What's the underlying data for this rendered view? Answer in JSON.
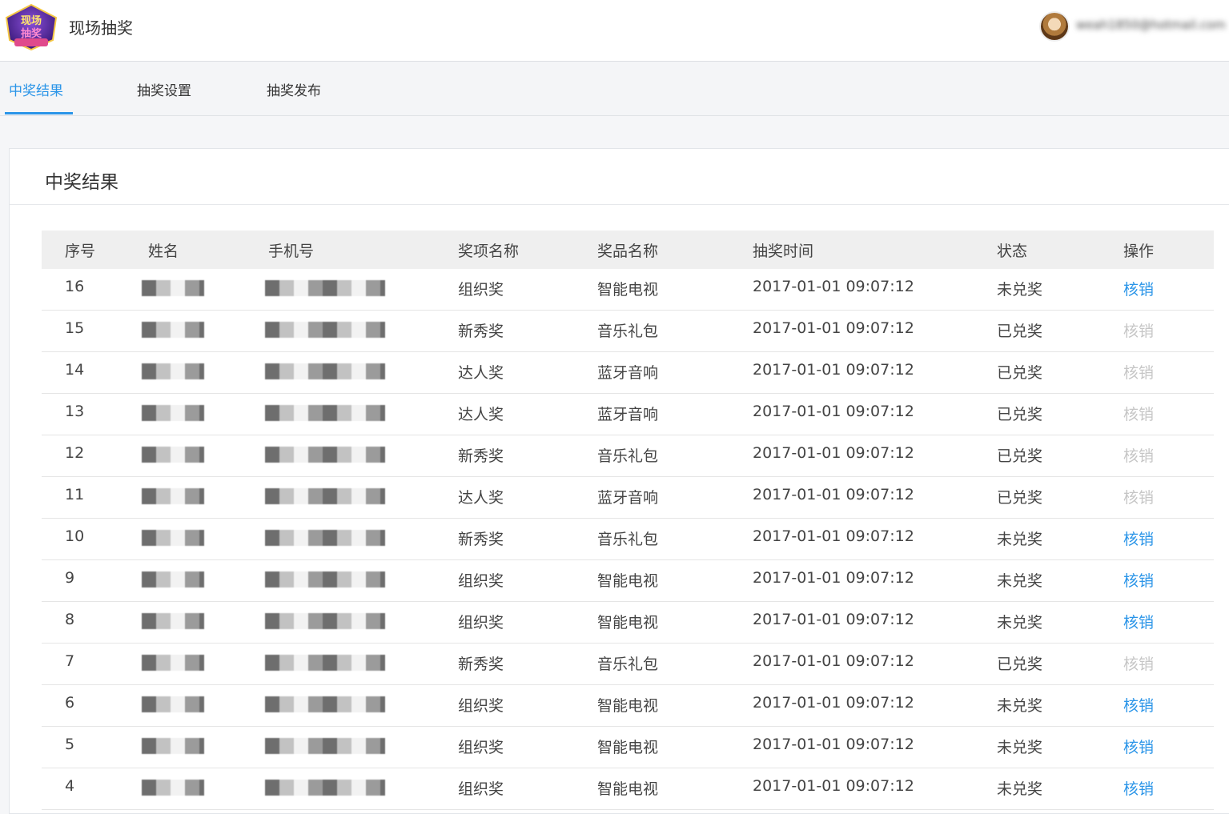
{
  "header": {
    "app_title": "现场抽奖",
    "logo_text_top": "现场",
    "logo_text_bottom": "抽奖",
    "user_email": "weah1850@hotmail.com"
  },
  "tabs": [
    {
      "label": "中奖结果",
      "active": true
    },
    {
      "label": "抽奖设置",
      "active": false
    },
    {
      "label": "抽奖发布",
      "active": false
    }
  ],
  "card": {
    "title": "中奖结果"
  },
  "table": {
    "columns": [
      "序号",
      "姓名",
      "手机号",
      "奖项名称",
      "奖品名称",
      "抽奖时间",
      "状态",
      "操作"
    ],
    "rows": [
      {
        "id": "16",
        "award": "组织奖",
        "prize": "智能电视",
        "time": "2017-01-01  09:07:12",
        "status": "未兑奖",
        "action": "核销",
        "action_enabled": true
      },
      {
        "id": "15",
        "award": "新秀奖",
        "prize": "音乐礼包",
        "time": "2017-01-01  09:07:12",
        "status": "已兑奖",
        "action": "核销",
        "action_enabled": false
      },
      {
        "id": "14",
        "award": "达人奖",
        "prize": "蓝牙音响",
        "time": "2017-01-01  09:07:12",
        "status": "已兑奖",
        "action": "核销",
        "action_enabled": false
      },
      {
        "id": "13",
        "award": "达人奖",
        "prize": "蓝牙音响",
        "time": "2017-01-01  09:07:12",
        "status": "已兑奖",
        "action": "核销",
        "action_enabled": false
      },
      {
        "id": "12",
        "award": "新秀奖",
        "prize": "音乐礼包",
        "time": "2017-01-01  09:07:12",
        "status": "已兑奖",
        "action": "核销",
        "action_enabled": false
      },
      {
        "id": "11",
        "award": "达人奖",
        "prize": "蓝牙音响",
        "time": "2017-01-01  09:07:12",
        "status": "已兑奖",
        "action": "核销",
        "action_enabled": false
      },
      {
        "id": "10",
        "award": "新秀奖",
        "prize": "音乐礼包",
        "time": "2017-01-01  09:07:12",
        "status": "未兑奖",
        "action": "核销",
        "action_enabled": true
      },
      {
        "id": "9",
        "award": "组织奖",
        "prize": "智能电视",
        "time": "2017-01-01  09:07:12",
        "status": "未兑奖",
        "action": "核销",
        "action_enabled": true
      },
      {
        "id": "8",
        "award": "组织奖",
        "prize": "智能电视",
        "time": "2017-01-01  09:07:12",
        "status": "未兑奖",
        "action": "核销",
        "action_enabled": true
      },
      {
        "id": "7",
        "award": "新秀奖",
        "prize": "音乐礼包",
        "time": "2017-01-01  09:07:12",
        "status": "已兑奖",
        "action": "核销",
        "action_enabled": false
      },
      {
        "id": "6",
        "award": "组织奖",
        "prize": "智能电视",
        "time": "2017-01-01  09:07:12",
        "status": "未兑奖",
        "action": "核销",
        "action_enabled": true
      },
      {
        "id": "5",
        "award": "组织奖",
        "prize": "智能电视",
        "time": "2017-01-01  09:07:12",
        "status": "未兑奖",
        "action": "核销",
        "action_enabled": true
      },
      {
        "id": "4",
        "award": "组织奖",
        "prize": "智能电视",
        "time": "2017-01-01  09:07:12",
        "status": "未兑奖",
        "action": "核销",
        "action_enabled": true
      }
    ]
  },
  "colors": {
    "accent": "#2b95e8",
    "disabled": "#c6c6c6",
    "header_bg": "#efefef"
  }
}
